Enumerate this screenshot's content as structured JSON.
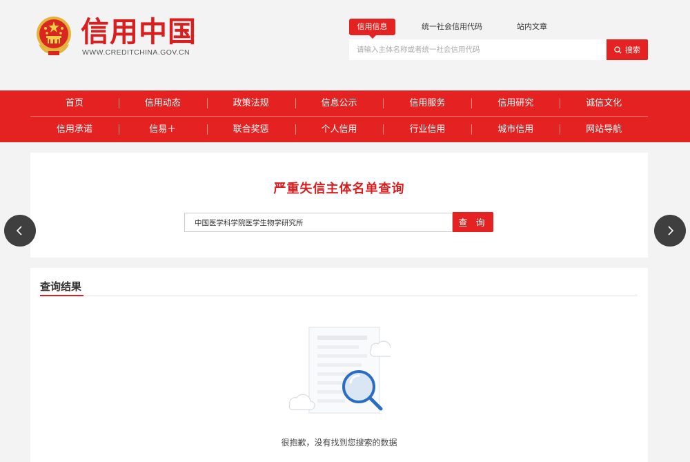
{
  "header": {
    "brand_cn": "信用中国",
    "brand_en": "WWW.CREDITCHINA.GOV.CN",
    "tabs": [
      {
        "label": "信用信息",
        "active": true
      },
      {
        "label": "统一社会信用代码",
        "active": false
      },
      {
        "label": "站内文章",
        "active": false
      }
    ],
    "search_placeholder": "请输入主体名称或者统一社会信用代码",
    "search_button": "搜索",
    "search_icon": "search-icon",
    "logo_icon": "national-emblem-icon"
  },
  "nav": {
    "row1": [
      "首页",
      "信用动态",
      "政策法规",
      "信息公示",
      "信用服务",
      "信用研究",
      "诚信文化"
    ],
    "row2": [
      "信用承诺",
      "信易＋",
      "联合奖惩",
      "个人信用",
      "行业信用",
      "城市信用",
      "网站导航"
    ]
  },
  "query": {
    "title": "严重失信主体名单查询",
    "input_value": "中国医学科学院医学生物学研究所",
    "button": "查 询"
  },
  "carousel": {
    "prev_icon": "chevron-left-icon",
    "next_icon": "chevron-right-icon"
  },
  "results": {
    "title": "查询结果",
    "empty_message": "很抱歉，没有找到您搜索的数据",
    "empty_icon": "no-results-illustration"
  },
  "colors": {
    "brand_red": "#e32221",
    "title_red": "#d81e1e",
    "page_bg": "#f3f3f3",
    "arrow_bg": "#3f3f3f",
    "illustration_blue": "#2a6fbf"
  }
}
